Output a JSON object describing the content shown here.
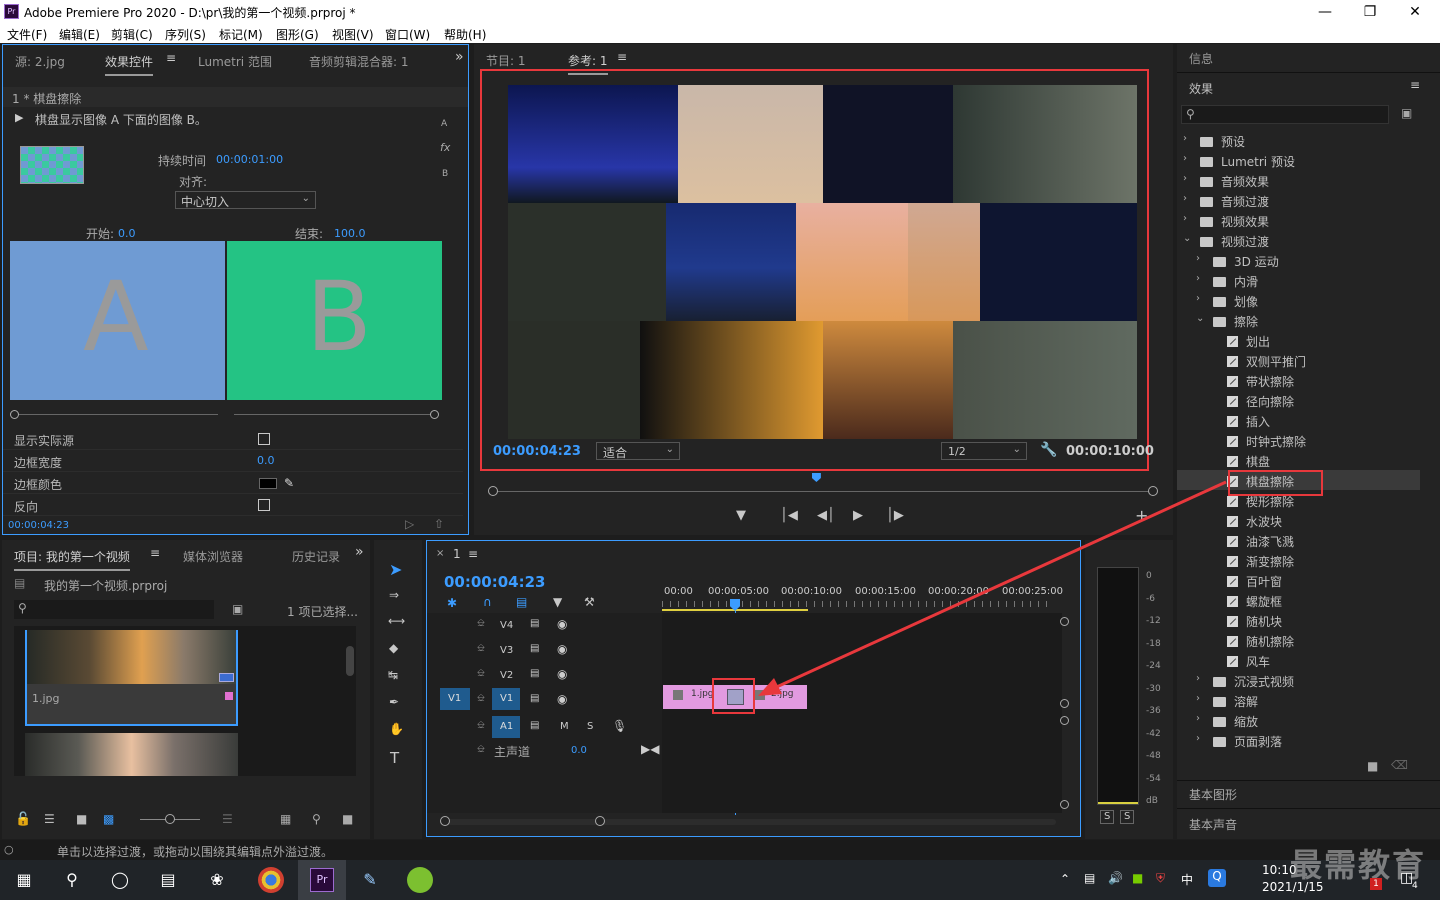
{
  "window": {
    "title": "Adobe Premiere Pro 2020 - D:\\pr\\我的第一个视频.prproj *",
    "logo": "Pr"
  },
  "menu": [
    "文件(F)",
    "编辑(E)",
    "剪辑(C)",
    "序列(S)",
    "标记(M)",
    "图形(G)",
    "视图(V)",
    "窗口(W)",
    "帮助(H)"
  ],
  "effect_controls": {
    "tabs": [
      "源: 2.jpg",
      "效果控件",
      "Lumetri 范围",
      "音频剪辑混合器: 1"
    ],
    "header": "1 * 棋盘擦除",
    "description": "棋盘显示图像 A 下面的图像 B。",
    "duration_label": "持续时间",
    "duration_value": "00:00:01:00",
    "align_label": "对齐:",
    "align_value": "中心切入",
    "start_label": "开始:",
    "start_value": "0.0",
    "end_label": "结束:",
    "end_value": "100.0",
    "a_label": "A",
    "b_label": "B",
    "side_letters": [
      "A",
      "fx",
      "B"
    ],
    "props": [
      {
        "label": "显示实际源",
        "value": ""
      },
      {
        "label": "边框宽度",
        "value": "0.0"
      },
      {
        "label": "边框颜色",
        "value": ""
      },
      {
        "label": "反向",
        "value": ""
      }
    ],
    "timecode": "00:00:04:23",
    "colors": {
      "a_box": "#6f9bd3",
      "b_box": "#24c384",
      "border": "#3c9cff"
    }
  },
  "program": {
    "tabs": [
      "节目: 1",
      "参考: 1"
    ],
    "timecode": "00:00:04:23",
    "fit": "适合",
    "resolution": "1/2",
    "duration": "00:00:10:00",
    "playhead": 0.49
  },
  "project": {
    "tabs": [
      "项目: 我的第一个视频",
      "媒体浏览器",
      "历史记录"
    ],
    "file": "我的第一个视频.prproj",
    "selected": "1 项已选择...",
    "items": [
      {
        "label": "1.jpg"
      }
    ]
  },
  "timeline": {
    "tab": "1",
    "timecode": "00:00:04:23",
    "ruler": [
      "00:00",
      "00:00:05:00",
      "00:00:10:00",
      "00:00:15:00",
      "00:00:20:00",
      "00:00:25:00"
    ],
    "tracks": [
      "V4",
      "V3",
      "V2",
      "V1",
      "A1"
    ],
    "source_patch": [
      "V1",
      "A1"
    ],
    "audio_buttons": [
      "M",
      "S"
    ],
    "master_label": "主声道",
    "master_value": "0.0",
    "clips": [
      "1.jpg",
      "2.jpg"
    ]
  },
  "meter": {
    "labels": [
      "0",
      "-6",
      "-12",
      "-18",
      "-24",
      "-30",
      "-36",
      "-42",
      "-48",
      "-54",
      "dB"
    ],
    "solo": [
      "S",
      "S"
    ]
  },
  "effects": {
    "info_tab": "信息",
    "title": "效果",
    "tree": [
      {
        "label": "预设",
        "level": 0,
        "kind": "preset"
      },
      {
        "label": "Lumetri 预设",
        "level": 0,
        "kind": "preset"
      },
      {
        "label": "音频效果",
        "level": 0,
        "kind": "folder"
      },
      {
        "label": "音频过渡",
        "level": 0,
        "kind": "folder"
      },
      {
        "label": "视频效果",
        "level": 0,
        "kind": "folder"
      },
      {
        "label": "视频过渡",
        "level": 0,
        "kind": "folder",
        "open": true
      },
      {
        "label": "3D 运动",
        "level": 1,
        "kind": "folder"
      },
      {
        "label": "内滑",
        "level": 1,
        "kind": "folder"
      },
      {
        "label": "划像",
        "level": 1,
        "kind": "folder"
      },
      {
        "label": "擦除",
        "level": 1,
        "kind": "folder",
        "open": true
      },
      {
        "label": "划出",
        "level": 2,
        "kind": "fx"
      },
      {
        "label": "双侧平推门",
        "level": 2,
        "kind": "fx"
      },
      {
        "label": "带状擦除",
        "level": 2,
        "kind": "fx"
      },
      {
        "label": "径向擦除",
        "level": 2,
        "kind": "fx"
      },
      {
        "label": "插入",
        "level": 2,
        "kind": "fx"
      },
      {
        "label": "时钟式擦除",
        "level": 2,
        "kind": "fx"
      },
      {
        "label": "棋盘",
        "level": 2,
        "kind": "fx"
      },
      {
        "label": "棋盘擦除",
        "level": 2,
        "kind": "fx",
        "selected": true
      },
      {
        "label": "楔形擦除",
        "level": 2,
        "kind": "fx"
      },
      {
        "label": "水波块",
        "level": 2,
        "kind": "fx"
      },
      {
        "label": "油漆飞溅",
        "level": 2,
        "kind": "fx"
      },
      {
        "label": "渐变擦除",
        "level": 2,
        "kind": "fx"
      },
      {
        "label": "百叶窗",
        "level": 2,
        "kind": "fx"
      },
      {
        "label": "螺旋框",
        "level": 2,
        "kind": "fx"
      },
      {
        "label": "随机块",
        "level": 2,
        "kind": "fx"
      },
      {
        "label": "随机擦除",
        "level": 2,
        "kind": "fx"
      },
      {
        "label": "风车",
        "level": 2,
        "kind": "fx"
      },
      {
        "label": "沉浸式视频",
        "level": 1,
        "kind": "folder"
      },
      {
        "label": "溶解",
        "level": 1,
        "kind": "folder"
      },
      {
        "label": "缩放",
        "level": 1,
        "kind": "folder"
      },
      {
        "label": "页面剥落",
        "level": 1,
        "kind": "folder"
      }
    ],
    "bottom_tabs": [
      "基本图形",
      "基本声音"
    ]
  },
  "status": "单击以选择过渡，或拖动以围绕其编辑点外溢过渡。",
  "taskbar": {
    "time": "10:10",
    "date": "2021/1/15",
    "ime": "中",
    "watermark": "最需教育",
    "badge1": "1",
    "badge2": "4"
  },
  "accent": "#e8383c"
}
